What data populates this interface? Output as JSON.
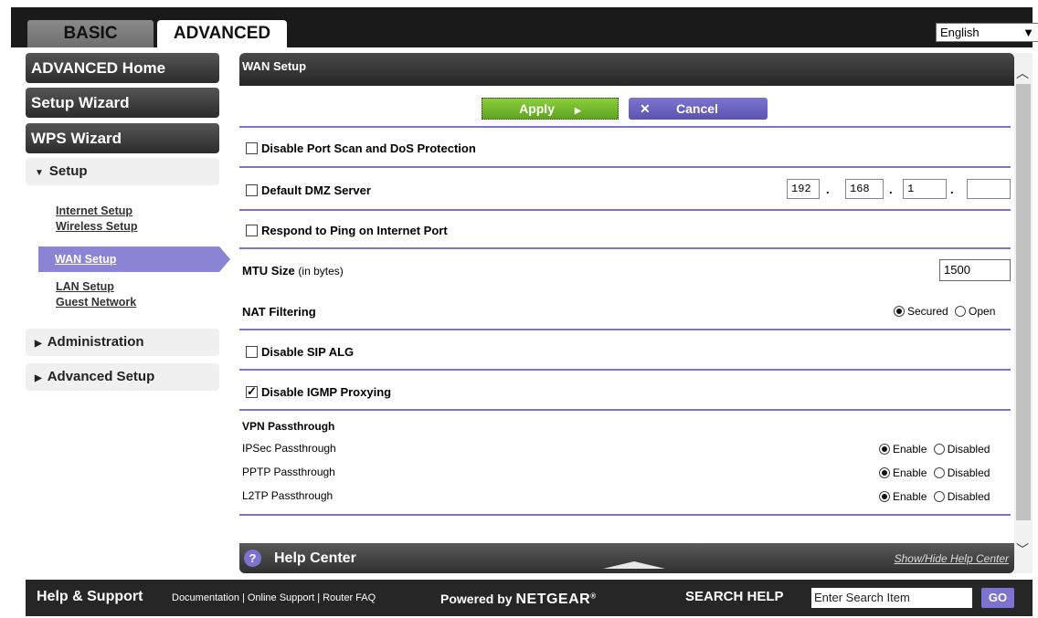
{
  "tabs": {
    "basic": "BASIC",
    "advanced": "ADVANCED"
  },
  "language": "English",
  "sidebar": {
    "advanced_home": "ADVANCED Home",
    "setup_wizard": "Setup Wizard",
    "wps_wizard": "WPS Wizard",
    "setup": "Setup",
    "setup_items": [
      "Internet Setup",
      "Wireless Setup",
      "WAN Setup",
      "LAN Setup",
      "Guest Network"
    ],
    "administration": "Administration",
    "advanced_setup": "Advanced Setup"
  },
  "panel": {
    "title": "WAN Setup",
    "apply": "Apply",
    "cancel": "Cancel",
    "disable_port_scan": "Disable Port Scan and DoS Protection",
    "default_dmz": "Default DMZ Server",
    "dmz_ip": [
      "192",
      "168",
      "1",
      ""
    ],
    "respond_ping": "Respond to Ping on Internet Port",
    "mtu_label": "MTU Size",
    "mtu_unit": "(in bytes)",
    "mtu_value": "1500",
    "nat_filtering": "NAT Filtering",
    "nat_secured": "Secured",
    "nat_open": "Open",
    "disable_sip_alg": "Disable SIP ALG",
    "disable_igmp": "Disable IGMP Proxying",
    "vpn_passthrough": "VPN Passthrough",
    "ipsec": "IPSec Passthrough",
    "pptp": "PPTP Passthrough",
    "l2tp": "L2TP Passthrough",
    "enable": "Enable",
    "disabled": "Disabled"
  },
  "help_center": {
    "title": "Help Center",
    "toggle": "Show/Hide Help Center"
  },
  "footer": {
    "help_support": "Help & Support",
    "documentation": "Documentation",
    "online_support": "Online Support",
    "router_faq": "Router FAQ",
    "powered_by": "Powered by",
    "brand": "NETGEAR",
    "search_help": "SEARCH HELP",
    "search_placeholder": "Enter Search Item",
    "go": "GO"
  }
}
